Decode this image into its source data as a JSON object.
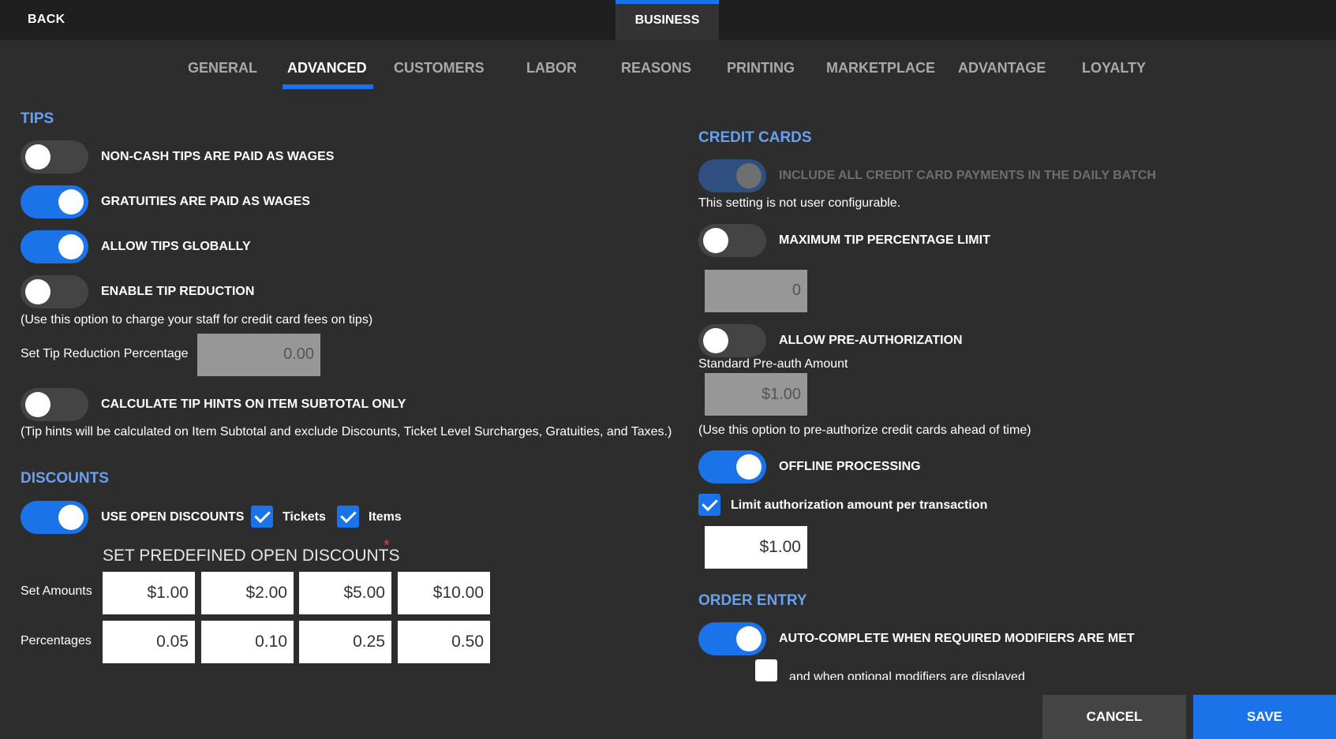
{
  "header": {
    "back_label": "BACK",
    "current_tab": "BUSINESS"
  },
  "tabs": [
    "GENERAL",
    "ADVANCED",
    "CUSTOMERS",
    "LABOR",
    "REASONS",
    "PRINTING",
    "MARKETPLACE",
    "ADVANTAGE",
    "LOYALTY"
  ],
  "active_tab": "ADVANCED",
  "tips": {
    "title": "TIPS",
    "non_cash": {
      "label": "NON-CASH TIPS ARE PAID AS WAGES",
      "on": false
    },
    "gratuities": {
      "label": "GRATUITIES ARE PAID AS WAGES",
      "on": true
    },
    "allow_tips": {
      "label": "ALLOW TIPS GLOBALLY",
      "on": true
    },
    "tip_reduction": {
      "label": "ENABLE TIP REDUCTION",
      "on": false
    },
    "tip_reduction_note": "(Use this option to charge your staff for credit card fees on tips)",
    "reduction_pct_label": "Set Tip Reduction Percentage",
    "reduction_pct_value": "0.00",
    "tip_hints": {
      "label": "CALCULATE TIP HINTS ON ITEM SUBTOTAL ONLY",
      "on": false
    },
    "tip_hints_note": "(Tip hints will be calculated on Item Subtotal and exclude Discounts, Ticket Level Surcharges, Gratuities, and Taxes.)"
  },
  "discounts": {
    "title": "DISCOUNTS",
    "open": {
      "label": "USE OPEN DISCOUNTS",
      "on": true
    },
    "tickets_label": "Tickets",
    "tickets_checked": true,
    "items_label": "Items",
    "items_checked": true,
    "predefined_title": "SET PREDEFINED OPEN DISCOUNTS",
    "required_mark": "*",
    "amounts_label": "Set Amounts",
    "amounts": [
      "$1.00",
      "$2.00",
      "$5.00",
      "$10.00"
    ],
    "percentages_label": "Percentages",
    "percentages": [
      "0.05",
      "0.10",
      "0.25",
      "0.50"
    ]
  },
  "credit_cards": {
    "title": "CREDIT CARDS",
    "daily_batch": {
      "label": "INCLUDE ALL CREDIT CARD PAYMENTS IN THE DAILY BATCH",
      "on": true,
      "disabled": true
    },
    "not_configurable_note": "This setting is not user configurable.",
    "max_tip": {
      "label": "MAXIMUM TIP PERCENTAGE LIMIT",
      "on": false
    },
    "max_tip_value": "0",
    "preauth": {
      "label": "ALLOW PRE-AUTHORIZATION",
      "on": false
    },
    "preauth_amount_label": "Standard Pre-auth Amount",
    "preauth_amount_value": "$1.00",
    "preauth_note": "(Use this option to pre-authorize credit cards ahead of time)",
    "offline": {
      "label": "OFFLINE PROCESSING",
      "on": true
    },
    "limit_auth_label": "Limit authorization amount per transaction",
    "limit_auth_checked": true,
    "limit_auth_value": "$1.00"
  },
  "order_entry": {
    "title": "ORDER ENTRY",
    "autocomplete": {
      "label": "AUTO-COMPLETE WHEN REQUIRED MODIFIERS ARE MET",
      "on": true
    },
    "optional_label": "and when optional modifiers are displayed",
    "optional_checked": false
  },
  "footer": {
    "cancel_label": "CANCEL",
    "save_label": "SAVE"
  },
  "colors": {
    "accent": "#1a73e8",
    "section_title": "#6aa0f0",
    "background": "#2d2d2d",
    "topbar": "#1f1f1f"
  }
}
